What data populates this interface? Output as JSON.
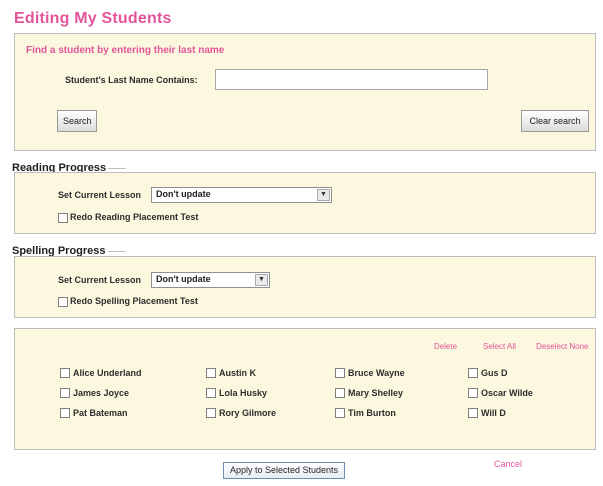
{
  "page": {
    "title": "Editing My Students"
  },
  "search": {
    "prompt": "Find a student by entering their last name",
    "last_name_label": "Student's Last Name Contains:",
    "last_name_value": "",
    "search_button": "Search",
    "clear_button": "Clear search"
  },
  "reading": {
    "title": "Reading Progress",
    "lesson_label": "Set Current Lesson",
    "lesson_value": "Don't update",
    "redo_label": "Redo Reading Placement Test"
  },
  "spelling": {
    "title": "Spelling Progress",
    "lesson_label": "Set Current Lesson",
    "lesson_value": "Don't update",
    "redo_label": "Redo Spelling Placement Test"
  },
  "students": {
    "actions": {
      "delete": "Delete",
      "select_all": "Select All",
      "deselect_none": "Deselect None"
    },
    "rows": [
      [
        "Alice Underland",
        "Austin K",
        "Bruce Wayne",
        "Gus D"
      ],
      [
        "James Joyce",
        "Lola Husky",
        "Mary Shelley",
        "Oscar Wilde"
      ],
      [
        "Pat Bateman",
        "Rory Gilmore",
        "Tim Burton",
        "Will D"
      ]
    ]
  },
  "footer": {
    "apply_button": "Apply to Selected Students",
    "cancel_link": "Cancel"
  },
  "colors": {
    "accent": "#e3549b",
    "panel_bg": "#fbf8df",
    "border": "#bdbdbd"
  }
}
